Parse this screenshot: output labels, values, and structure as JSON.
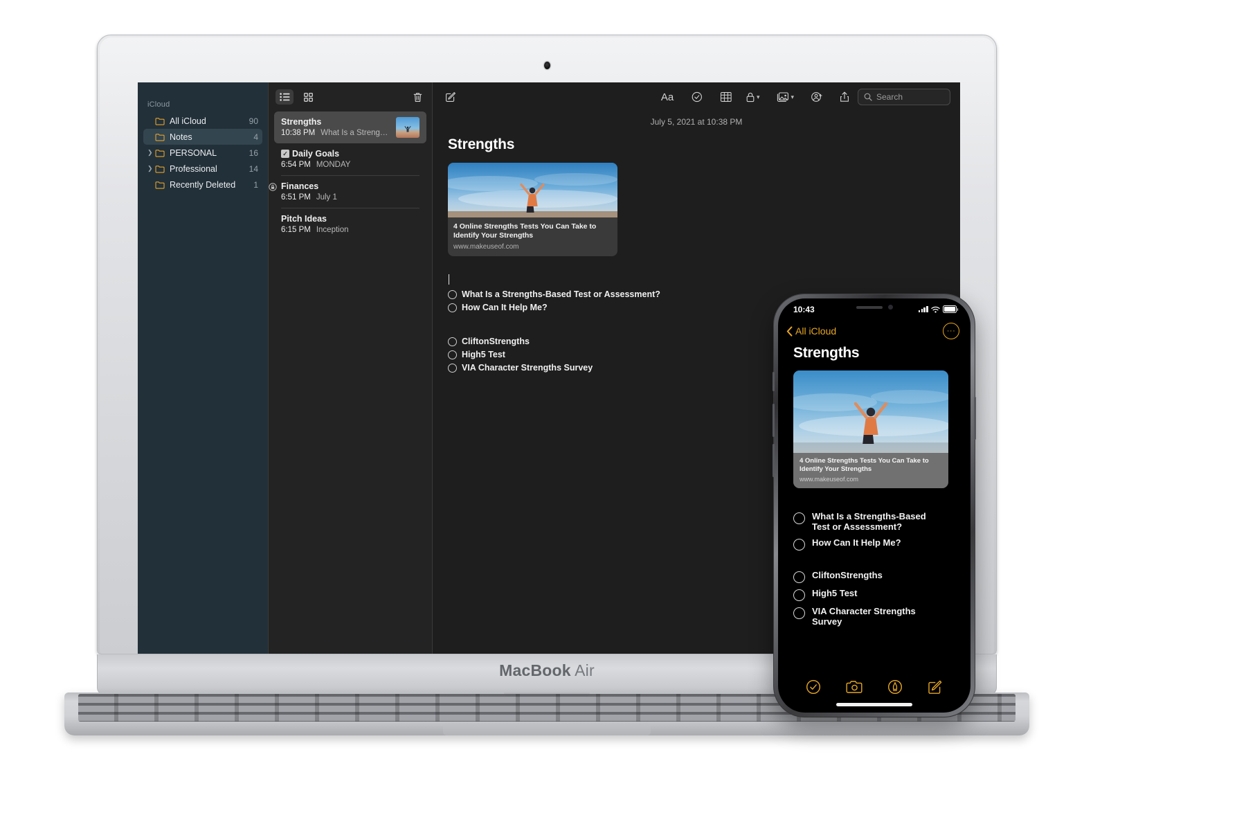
{
  "device": {
    "laptop_brand_bold": "MacBook",
    "laptop_brand_light": "Air"
  },
  "mac": {
    "sidebar": {
      "section_header": "iCloud",
      "items": [
        {
          "label": "All iCloud",
          "count": "90",
          "expandable": false,
          "selected": false
        },
        {
          "label": "Notes",
          "count": "4",
          "expandable": false,
          "selected": true
        },
        {
          "label": "PERSONAL",
          "count": "16",
          "expandable": true,
          "selected": false
        },
        {
          "label": "Professional",
          "count": "14",
          "expandable": true,
          "selected": false
        },
        {
          "label": "Recently Deleted",
          "count": "1",
          "expandable": false,
          "selected": false
        }
      ]
    },
    "list_toolbar": {
      "list_view_icon": "list-view-icon",
      "gallery_view_icon": "gallery-view-icon",
      "delete_icon": "trash-icon"
    },
    "notes": [
      {
        "title": "Strengths",
        "time": "10:38 PM",
        "preview": "What Is a Streng…",
        "selected": true,
        "badge": "none",
        "thumbnail": true
      },
      {
        "title": "Daily Goals",
        "time": "6:54 PM",
        "preview": "MONDAY",
        "selected": false,
        "badge": "checklist",
        "thumbnail": false
      },
      {
        "title": "Finances",
        "time": "6:51 PM",
        "preview": "July 1",
        "selected": false,
        "badge": "locked",
        "thumbnail": false
      },
      {
        "title": "Pitch Ideas",
        "time": "6:15 PM",
        "preview": "Inception",
        "selected": false,
        "badge": "none",
        "thumbnail": false
      }
    ],
    "editor_toolbar": {
      "compose_icon": "compose-icon",
      "format_label": "Aa",
      "checklist_icon": "checklist-icon",
      "table_icon": "table-icon",
      "lock_icon": "lock-icon",
      "media_icon": "media-icon",
      "collaborate_icon": "add-people-icon",
      "share_icon": "share-icon"
    },
    "search": {
      "placeholder": "Search",
      "value": "",
      "icon": "search-icon"
    },
    "note": {
      "date": "July 5, 2021 at 10:38 PM",
      "title": "Strengths",
      "link_card": {
        "headline": "4 Online Strengths Tests You Can Take to Identify Your Strengths",
        "url": "www.makeuseof.com"
      },
      "checklist_group_1": [
        "What Is a Strengths-Based Test or Assessment?",
        "How Can It Help Me?"
      ],
      "checklist_group_2": [
        "CliftonStrengths",
        "High5 Test",
        "VIA Character Strengths Survey"
      ]
    }
  },
  "iphone": {
    "status": {
      "time": "10:43",
      "cellular_icon": "cellular-bars-icon",
      "wifi_icon": "wifi-icon",
      "battery_icon": "battery-icon"
    },
    "nav": {
      "back_label": "All iCloud",
      "back_icon": "chevron-left-icon",
      "more_label": "···",
      "more_icon": "more-options-icon"
    },
    "title": "Strengths",
    "link_card": {
      "headline": "4 Online Strengths Tests You Can Take to Identify Your Strengths",
      "url": "www.makeuseof.com"
    },
    "checklist_group_1": [
      "What Is a Strengths-Based Test or Assessment?",
      "How Can It Help Me?"
    ],
    "checklist_group_2": [
      "CliftonStrengths",
      "High5 Test",
      "VIA Character Strengths Survey"
    ],
    "toolbar": [
      {
        "icon": "checklist-circle-icon"
      },
      {
        "icon": "camera-icon"
      },
      {
        "icon": "markup-pen-icon"
      },
      {
        "icon": "compose-icon"
      }
    ]
  },
  "colors": {
    "accent_yellow": "#e8a723",
    "folder_yellow": "#e5a32c",
    "sidebar_bg": "#223039",
    "list_bg": "#232323",
    "editor_bg": "#1e1e1e"
  }
}
